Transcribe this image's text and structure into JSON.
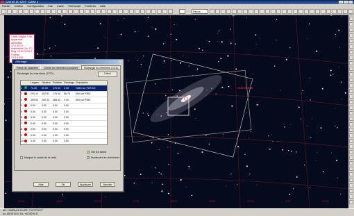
{
  "window": {
    "title": "Carnet du Ciel - Carte 1"
  },
  "menu": [
    "Fichier",
    "Edition",
    "Configuration",
    "Vue",
    "Carte",
    "Télescope",
    "Fenêtres",
    "Aide"
  ],
  "toolbar": {
    "fov_label": "Heure"
  },
  "infobox": {
    "lines": [
      "Carte: Alkyba 7 Mir",
      "Apparente",
      "Azimutale",
      "27.4.09.23",
      "Imbrederta (Gu 27)",
      "Mag: 10.9/13.0/6.0",
      "Champ: 1°01'0.000\""
    ]
  },
  "objects": {
    "galaxy_label": "Andromède"
  },
  "axes": {
    "bottom": [
      "21°00'",
      "18°00'",
      "15°00'",
      "12°00'",
      "09°00'",
      "06°00'",
      "03°00'",
      "0°00'",
      "57°00'"
    ],
    "right": [
      "-",
      "-",
      "-",
      "-",
      "-",
      "-",
      "-",
      "-",
      "-",
      "-"
    ]
  },
  "dialog": {
    "title": "Affichage",
    "tabs": [
      "Police de caractère",
      "Cercle du chercheur (oculaire)",
      "Rectangle du chercheur (CCD)"
    ],
    "section_label": "Rectangle du chercheur (CCD)",
    "calc_button": "Calcul",
    "columns": [
      "",
      "",
      "Largeur",
      "Hauteur",
      "Rotation",
      "Décalage",
      "Description"
    ],
    "rows": [
      {
        "num": "1",
        "green": true,
        "w": "74.40",
        "h": "60.00",
        "rot": "170.93",
        "dec": "0.00",
        "desc": "Hdtm sur FUT100",
        "selected": true
      },
      {
        "num": "2",
        "green": false,
        "w": "200.10",
        "h": "302.52",
        "rot": "176.43",
        "dec": "56.76",
        "desc": "650 sur P360",
        "selected": false
      },
      {
        "num": "3",
        "green": false,
        "w": "309.52",
        "h": "200.34",
        "rot": "268.43",
        "dec": "0.00",
        "desc": "650 sur P360",
        "selected": false
      },
      {
        "num": "4",
        "green": false,
        "w": "0.00",
        "h": "0.00",
        "rot": "0.00",
        "dec": "0.00",
        "desc": "",
        "selected": false
      },
      {
        "num": "5",
        "green": false,
        "w": "0.00",
        "h": "0.00",
        "rot": "0.00",
        "dec": "0.00",
        "desc": "",
        "selected": false
      },
      {
        "num": "6",
        "green": false,
        "w": "0.00",
        "h": "0.00",
        "rot": "0.00",
        "dec": "0.00",
        "desc": "",
        "selected": false
      },
      {
        "num": "7",
        "green": false,
        "w": "0.00",
        "h": "0.00",
        "rot": "0.00",
        "dec": "0.00",
        "desc": "",
        "selected": false
      },
      {
        "num": "8",
        "green": false,
        "w": "0.00",
        "h": "0.00",
        "rot": "0.00",
        "dec": "0.00",
        "desc": "",
        "selected": false
      },
      {
        "num": "9",
        "green": false,
        "w": "0.00",
        "h": "0.00",
        "rot": "0.00",
        "dec": "0.00",
        "desc": "",
        "selected": false
      },
      {
        "num": "10",
        "green": false,
        "w": "0.00",
        "h": "0.00",
        "rot": "0.00",
        "dec": "0.00",
        "desc": "",
        "selected": false
      }
    ],
    "check_labels": "Voir les labels",
    "check_mark_center": "Marquer le centre de la carte",
    "check_numbered": "Numéroter les chercheurs",
    "buttons": {
      "help": "Aide",
      "ok": "Ok",
      "apply": "Appliquer",
      "cancel": "Annuler"
    }
  },
  "status": {
    "line1": "AD: 10h50m44.24s  DE: +34°37'00.0\"",
    "line2": "Az: 65°00'00.0\"  Hz: +40°00'00.0\""
  }
}
